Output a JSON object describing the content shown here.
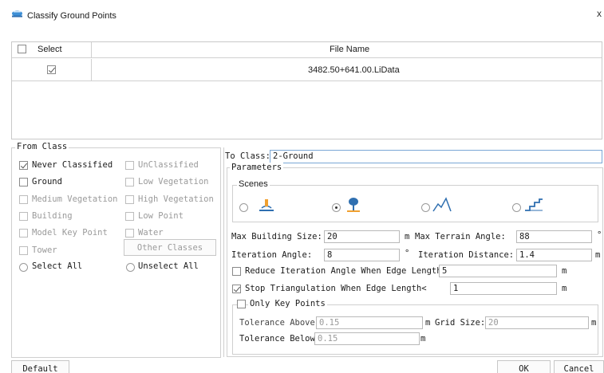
{
  "window": {
    "title": "Classify Ground Points",
    "close_glyph": "x"
  },
  "file_table": {
    "col_select": "Select",
    "col_file": "File Name",
    "rows": [
      {
        "checked": true,
        "file_name": "3482.50+641.00.LiData"
      }
    ]
  },
  "from_class": {
    "legend": "From Class",
    "left": [
      {
        "label": "Never Classified",
        "checked": true,
        "enabled": true
      },
      {
        "label": "Ground",
        "checked": false,
        "enabled": true
      },
      {
        "label": "Medium Vegetation",
        "checked": false,
        "enabled": false
      },
      {
        "label": "Building",
        "checked": false,
        "enabled": false
      },
      {
        "label": "Model Key Point",
        "checked": false,
        "enabled": false
      },
      {
        "label": "Tower",
        "checked": false,
        "enabled": false
      }
    ],
    "right": [
      {
        "label": "UnClassified",
        "checked": false,
        "enabled": false
      },
      {
        "label": "Low Vegetation",
        "checked": false,
        "enabled": false
      },
      {
        "label": "High Vegetation",
        "checked": false,
        "enabled": false
      },
      {
        "label": "Low Point",
        "checked": false,
        "enabled": false
      },
      {
        "label": "Water",
        "checked": false,
        "enabled": false
      }
    ],
    "other_classes": "Other Classes",
    "select_all": "Select All",
    "unselect_all": "Unselect All"
  },
  "to_class": {
    "label": "To Class:",
    "value": "2-Ground"
  },
  "parameters": {
    "legend": "Parameters",
    "scenes_legend": "Scenes",
    "scene_icons": [
      "flat-terrain-icon",
      "tree-icon",
      "mountain-icon",
      "stairs-icon"
    ],
    "selected_scene": 1,
    "max_building_size": {
      "label": "Max Building Size:",
      "value": "20",
      "unit": "m"
    },
    "max_terrain_angle": {
      "label": "Max Terrain Angle:",
      "value": "88",
      "unit": "°"
    },
    "iteration_angle": {
      "label": "Iteration Angle:",
      "value": "8",
      "unit": "°"
    },
    "iteration_distance": {
      "label": "Iteration Distance:",
      "value": "1.4",
      "unit": "m"
    },
    "reduce_iteration": {
      "label": "Reduce Iteration Angle When Edge Length<",
      "value": "5",
      "unit": "m",
      "checked": false
    },
    "stop_triangulation": {
      "label": "Stop Triangulation When Edge Length<",
      "value": "1",
      "unit": "m",
      "checked": true
    },
    "only_key_points": {
      "label": "Only Key Points",
      "checked": false,
      "tolerance_above": {
        "label": "Tolerance Above",
        "value": "0.15",
        "unit": "m"
      },
      "grid_size": {
        "label": "Grid Size:",
        "value": "20",
        "unit": "m"
      },
      "tolerance_below": {
        "label": "Tolerance Below",
        "value": "0.15",
        "unit": "m"
      }
    }
  },
  "footer": {
    "default": "Default",
    "ok": "OK",
    "cancel": "Cancel"
  }
}
